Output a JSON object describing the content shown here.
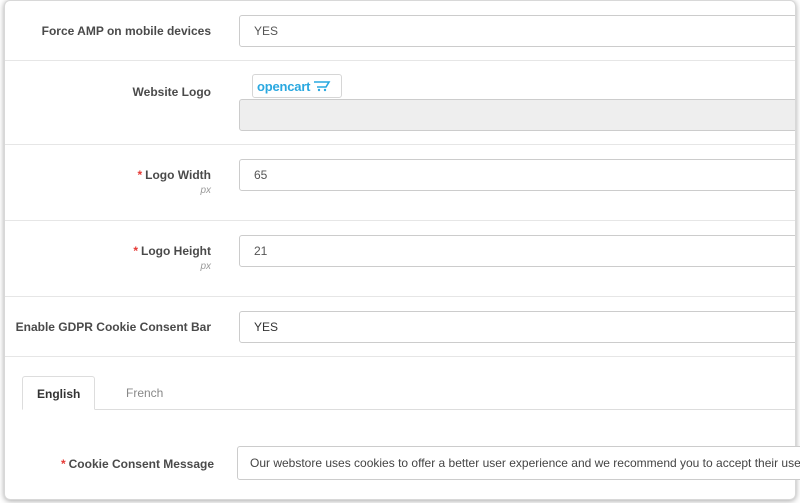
{
  "form": {
    "force_amp": {
      "label": "Force AMP on mobile devices",
      "value": "YES"
    },
    "website_logo": {
      "label": "Website Logo",
      "logo_text": "opencart",
      "input_value": ""
    },
    "logo_width": {
      "required_mark": "*",
      "label": "Logo Width",
      "unit": "px",
      "value": "65"
    },
    "logo_height": {
      "required_mark": "*",
      "label": "Logo Height",
      "unit": "px",
      "value": "21"
    },
    "gdpr_bar": {
      "label": "Enable GDPR Cookie Consent Bar",
      "value": "YES"
    },
    "tabs": [
      {
        "label": "English",
        "active": true
      },
      {
        "label": "French",
        "active": false
      }
    ],
    "cookie_message": {
      "required_mark": "*",
      "label": "Cookie Consent Message",
      "value": "Our webstore uses cookies to offer a better user experience and we recommend you to accept their use to fully enjoy the navigation."
    }
  },
  "colors": {
    "required": "#e53935",
    "logo": "#29a8e0",
    "border": "#cccccc"
  }
}
